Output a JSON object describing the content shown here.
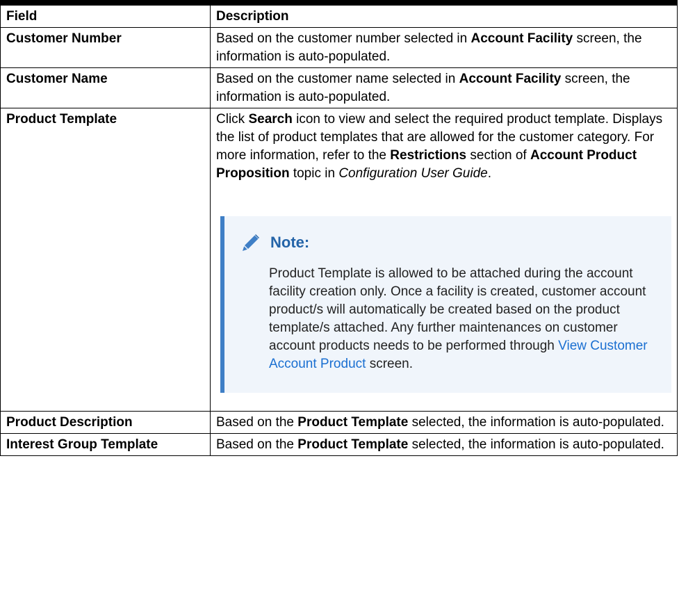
{
  "table": {
    "headers": {
      "field": "Field",
      "description": "Description"
    },
    "rows": [
      {
        "field": "Customer Number",
        "desc_a": "Based on the customer number selected in ",
        "desc_b": "Account Facility",
        "desc_c": " screen, the information is auto-populated."
      },
      {
        "field": "Customer Name",
        "desc_a": "Based on the customer name selected in ",
        "desc_b": "Account Facility",
        "desc_c": " screen, the information is auto-populated."
      },
      {
        "field": "Product Template",
        "p1": "Click ",
        "p2": "Search",
        "p3": " icon to view and select the required product template. Displays the list of product templates that are allowed for the customer category. For more information, refer to the ",
        "p4": "Restrictions",
        "p5": " section of ",
        "p6": "Account Product Proposition",
        "p7": " topic in ",
        "p8": "Configuration User Guide",
        "p9": ".",
        "note": {
          "icon": "pencil-icon",
          "title": "Note:",
          "body": "Product Template is allowed to be attached during the account facility creation only. Once a facility is created, customer account product/s will automatically be created based on the product template/s attached. Any further maintenances on customer account products needs to be performed through ",
          "link": "View Customer Account Product",
          "tail": " screen."
        }
      },
      {
        "field": "Product Description",
        "desc_a": "Based on the ",
        "desc_b": "Product Template",
        "desc_c": " selected, the information is auto-populated."
      },
      {
        "field": "Interest Group Template",
        "desc_a": "Based on the ",
        "desc_b": "Product Template",
        "desc_c": " selected, the information is auto-populated."
      }
    ]
  },
  "colors": {
    "note_accent": "#3f7fc6",
    "note_background": "#f0f5fb",
    "note_title": "#2464a8",
    "link": "#1a6fd1"
  }
}
